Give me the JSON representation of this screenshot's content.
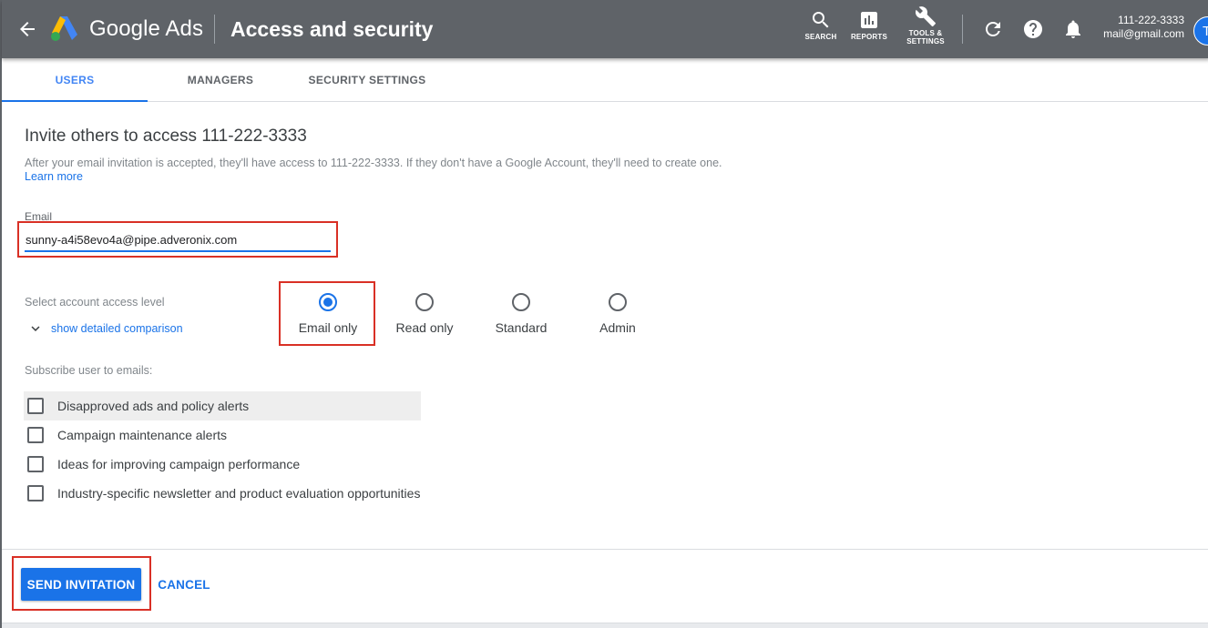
{
  "header": {
    "brand": "Google Ads",
    "page_title": "Access and security",
    "tools": {
      "search": "SEARCH",
      "reports": "REPORTS",
      "tools_line1": "TOOLS &",
      "tools_line2": "SETTINGS"
    },
    "account_id": "111-222-3333",
    "account_email": "mail@gmail.com",
    "avatar_initial": "T"
  },
  "tabs": [
    {
      "label": "USERS",
      "active": true
    },
    {
      "label": "MANAGERS",
      "active": false
    },
    {
      "label": "SECURITY SETTINGS",
      "active": false
    }
  ],
  "invite": {
    "title": "Invite others to access 111-222-3333",
    "description": "After your email invitation is accepted, they'll have access to 111-222-3333. If they don't have a Google Account, they'll need to create one.",
    "learn_more": "Learn more"
  },
  "email": {
    "label": "Email",
    "value": "sunny-a4i58evo4a@pipe.adveronix.com"
  },
  "access": {
    "label": "Select account access level",
    "comparison_link": "show detailed comparison",
    "options": [
      {
        "label": "Email only",
        "selected": true
      },
      {
        "label": "Read only",
        "selected": false
      },
      {
        "label": "Standard",
        "selected": false
      },
      {
        "label": "Admin",
        "selected": false
      }
    ]
  },
  "subscribe": {
    "label": "Subscribe user to emails:",
    "options": [
      {
        "label": "Disapproved ads and policy alerts",
        "checked": false
      },
      {
        "label": "Campaign maintenance alerts",
        "checked": false
      },
      {
        "label": "Ideas for improving campaign performance",
        "checked": false
      },
      {
        "label": "Industry-specific newsletter and product evaluation opportunities",
        "checked": false
      }
    ]
  },
  "actions": {
    "send": "SEND INVITATION",
    "cancel": "CANCEL"
  },
  "colors": {
    "header_bg": "#5f6368",
    "accent": "#1a73e8",
    "highlight": "#d93025"
  }
}
